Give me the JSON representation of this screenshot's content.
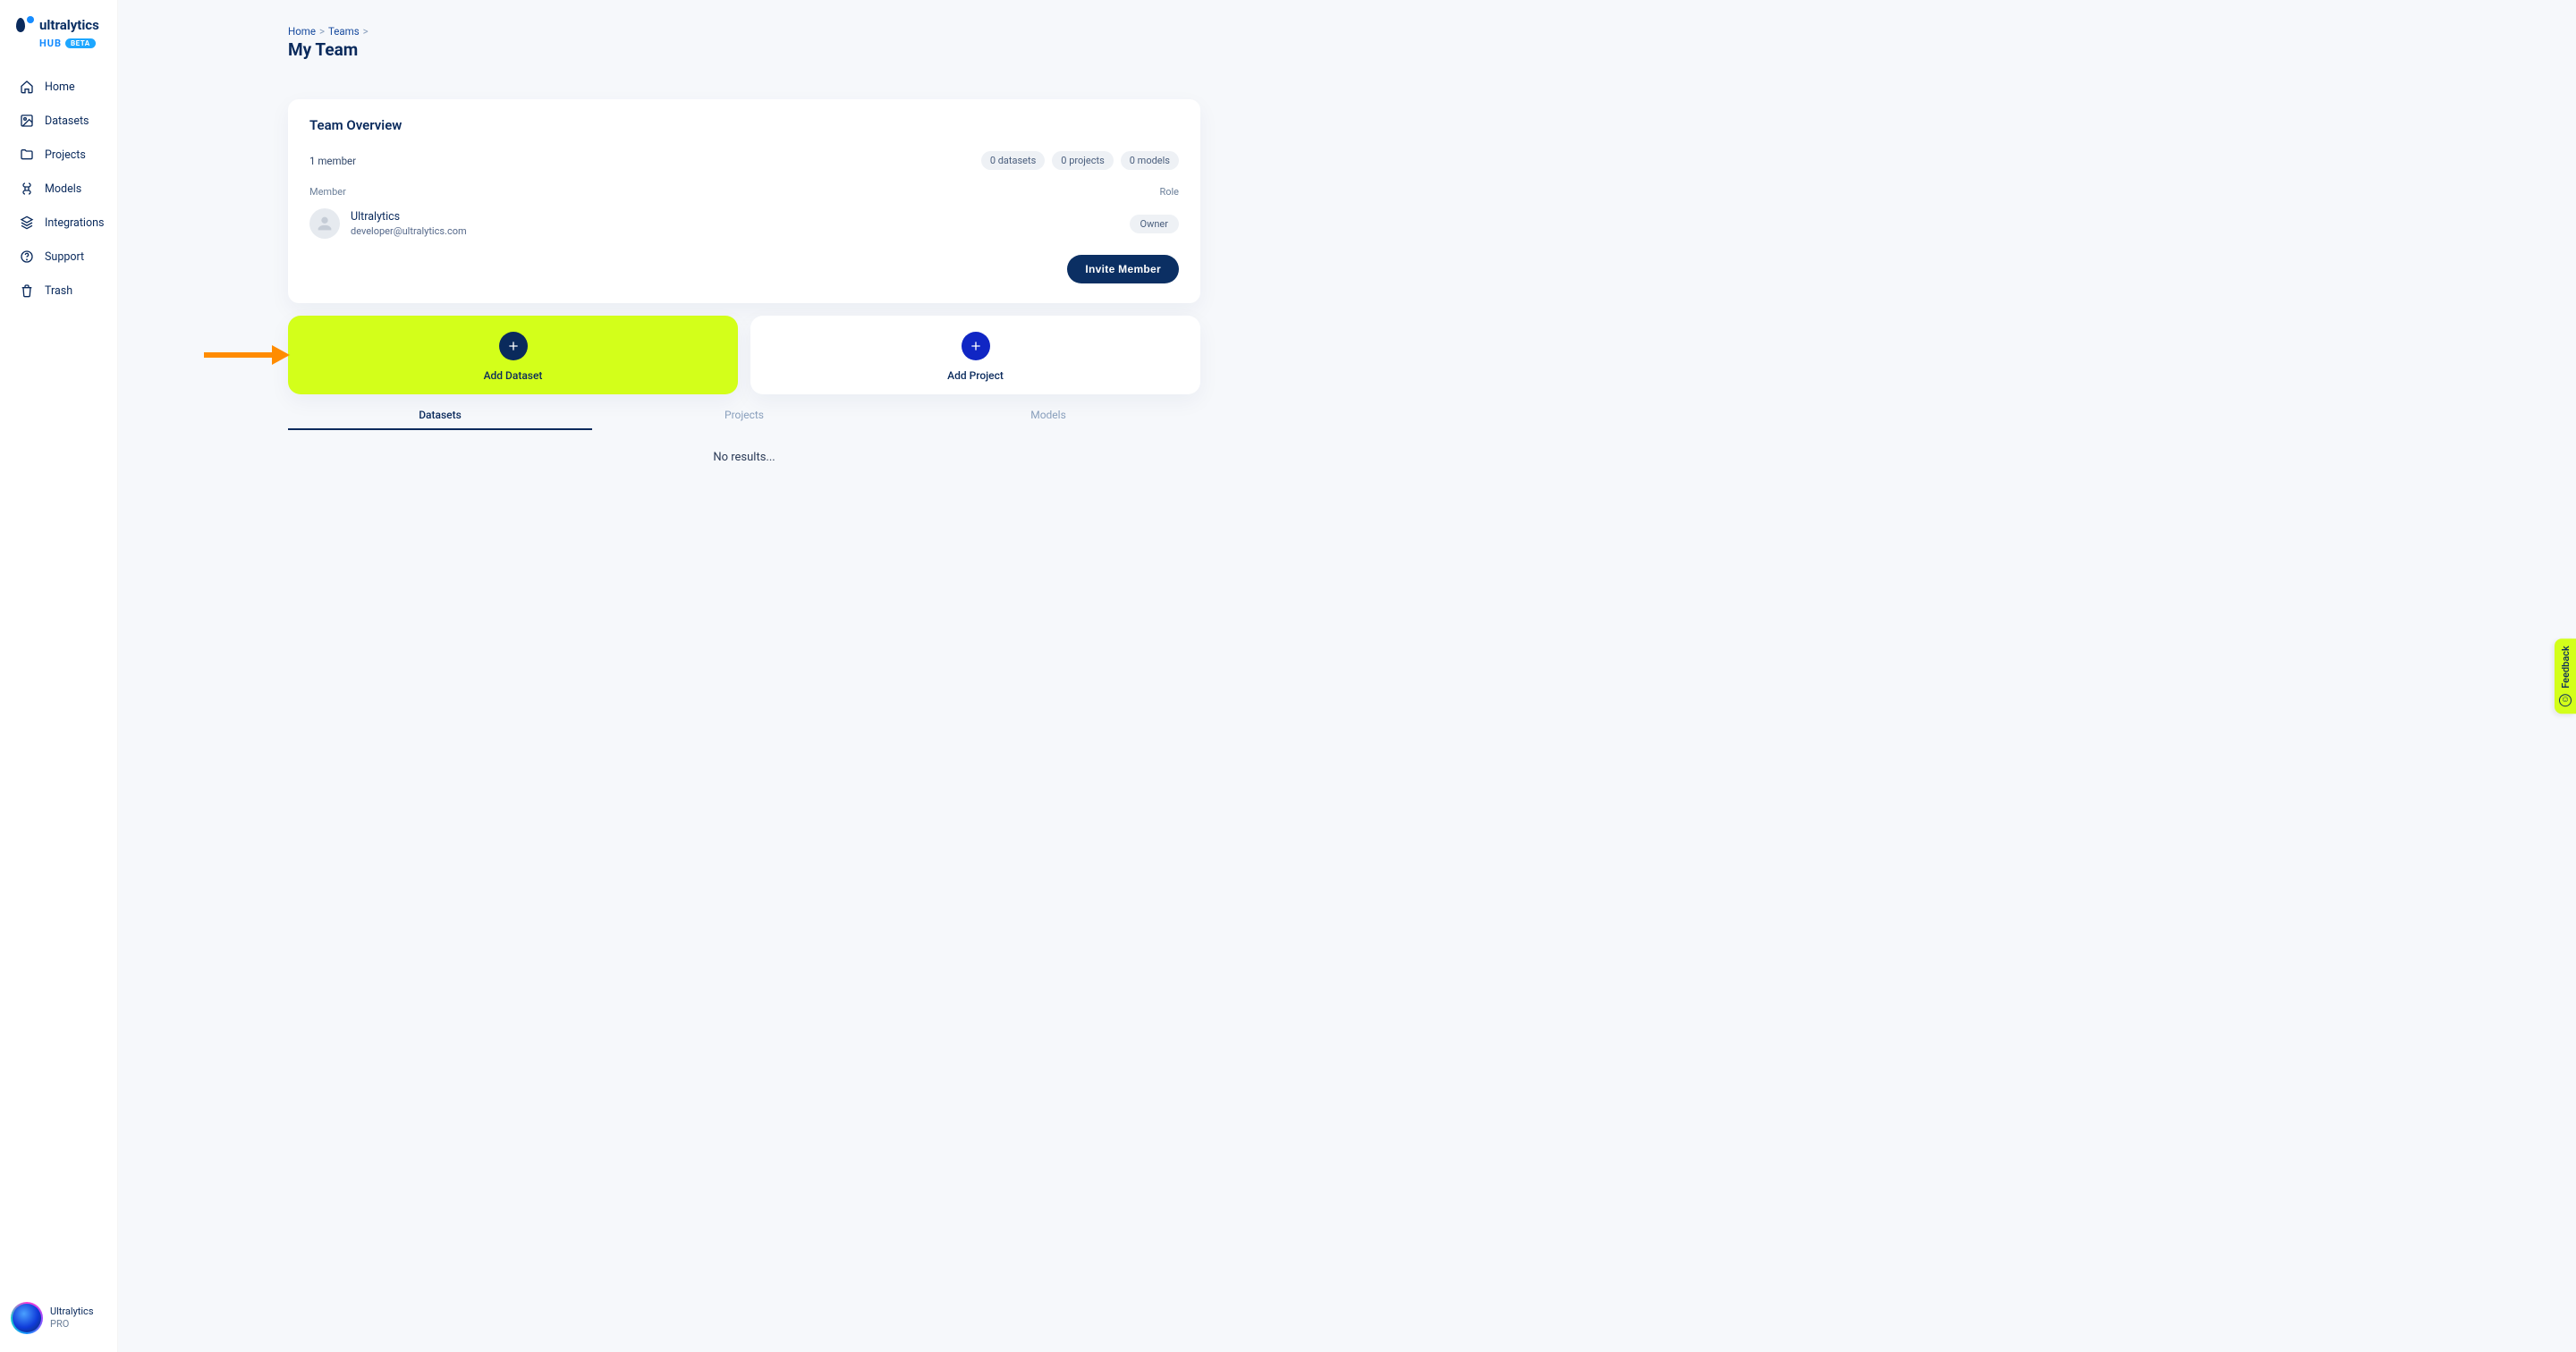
{
  "brand": {
    "name": "ultralytics",
    "sub": "HUB",
    "badge": "BETA"
  },
  "sidebar": {
    "items": [
      {
        "label": "Home",
        "icon": "home-icon"
      },
      {
        "label": "Datasets",
        "icon": "image-icon"
      },
      {
        "label": "Projects",
        "icon": "folder-icon"
      },
      {
        "label": "Models",
        "icon": "command-icon"
      },
      {
        "label": "Integrations",
        "icon": "layers-icon"
      },
      {
        "label": "Support",
        "icon": "help-icon"
      },
      {
        "label": "Trash",
        "icon": "trash-icon"
      }
    ],
    "user": {
      "name": "Ultralytics",
      "plan": "PRO"
    }
  },
  "breadcrumb": {
    "home": "Home",
    "teams": "Teams",
    "sep": ">"
  },
  "page_title": "My Team",
  "overview": {
    "title": "Team Overview",
    "member_count": "1 member",
    "chips": {
      "datasets": "0 datasets",
      "projects": "0 projects",
      "models": "0 models"
    },
    "col_member": "Member",
    "col_role": "Role",
    "member": {
      "name": "Ultralytics",
      "email": "developer@ultralytics.com",
      "role": "Owner"
    },
    "invite_label": "Invite Member"
  },
  "tiles": {
    "add_dataset": "Add Dataset",
    "add_project": "Add Project"
  },
  "tabs": {
    "datasets": "Datasets",
    "projects": "Projects",
    "models": "Models"
  },
  "no_results": "No results...",
  "feedback": "Feedback"
}
